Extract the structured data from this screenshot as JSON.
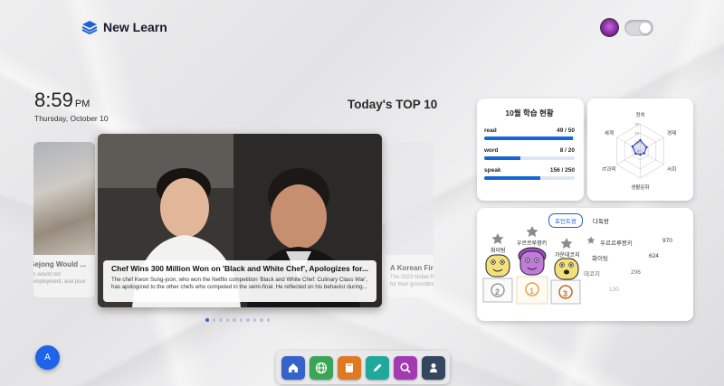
{
  "app": {
    "name": "New Learn"
  },
  "clock": {
    "time": "8:59",
    "ampm": "PM",
    "date": "Thursday, October 10"
  },
  "section_title": "Today's TOP 10",
  "carousel": {
    "left": {
      "title": "Sejong Would ...",
      "desc_lines": [
        "ts would not",
        "employment, and poor"
      ]
    },
    "main": {
      "title": "Chef Wins 300 Million Won on 'Black and White Chef', Apologizes for...",
      "desc": "The chef Kwon Sung-joon, who won the Netflix competition 'Black and White Chef: Culinary Class War', has apologized to the other chefs who competed in the semi-final. He reflected on his behavior during..."
    },
    "right": {
      "title": "A Korean First",
      "desc_lines": [
        "The 2023 Nobel Priz",
        "for their groundbrea"
      ]
    },
    "dots_total": 10,
    "active_dot": 0
  },
  "fab": {
    "label": "A"
  },
  "study": {
    "title": "10월 학습 현황",
    "rows": [
      {
        "label": "read",
        "value_text": "49 / 50",
        "fraction": 0.98
      },
      {
        "label": "word",
        "value_text": "8 / 20",
        "fraction": 0.4
      },
      {
        "label": "speak",
        "value_text": "156 / 250",
        "fraction": 0.624
      }
    ]
  },
  "radar": {
    "axes": [
      "정치",
      "경제",
      "사회",
      "생활문화",
      "IT과학",
      "세계"
    ],
    "ticks": [
      "30",
      "20",
      "10",
      "0"
    ],
    "max": 30,
    "values": [
      12,
      8,
      5,
      4,
      6,
      10
    ],
    "color": "#1f3fa8"
  },
  "ranking": {
    "tabs": [
      "포인트왕",
      "다독왕"
    ],
    "active_tab": "포인트왕",
    "podium": [
      {
        "rank": "2",
        "name": "화이팅"
      },
      {
        "rank": "1",
        "name": "우르르루쾅키"
      },
      {
        "rank": "3",
        "name": "가운데코지"
      }
    ],
    "list": [
      {
        "name": "우르르루쾅키",
        "points": "970"
      },
      {
        "name": "화이팅",
        "points": "624"
      },
      {
        "name": "데코지",
        "points": "206"
      },
      {
        "name": "",
        "points": "130"
      }
    ]
  },
  "dock": {
    "apps": [
      {
        "icon": "home-icon",
        "color": "#3563c9"
      },
      {
        "icon": "globe-icon",
        "color": "#3aa655"
      },
      {
        "icon": "book-icon",
        "color": "#e07a22"
      },
      {
        "icon": "pencil-icon",
        "color": "#1fa89b"
      },
      {
        "icon": "search-icon",
        "color": "#a43ab0"
      },
      {
        "icon": "user-icon",
        "color": "#35465f"
      }
    ]
  }
}
